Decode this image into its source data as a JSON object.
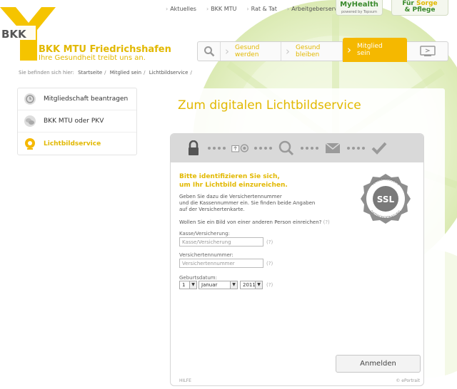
{
  "brand": {
    "logo_text": "BKK",
    "title": "BKK MTU Friedrichshafen",
    "tagline": "Ihre Gesundheit treibt uns an."
  },
  "topnav": {
    "items": [
      "Aktuelles",
      "BKK MTU",
      "Rat & Tat",
      "Arbeitgeberservice"
    ]
  },
  "partners": {
    "myhealth": "MyHealth",
    "myhealth_sub": "powered by Topsum",
    "pflege_prefix": "Für",
    "pflege_1": "Sorge",
    "pflege_2": "& Pflege"
  },
  "mainnav": {
    "item1_l1": "Gesund",
    "item1_l2": "werden",
    "item2_l1": "Gesund",
    "item2_l2": "bleiben",
    "item3_l1": "Mitglied",
    "item3_l2": "sein"
  },
  "breadcrumb": {
    "prefix": "Sie befinden sich hier:",
    "items": [
      "Startseite",
      "Mitglied sein",
      "Lichtbildservice"
    ]
  },
  "sidebar": {
    "items": [
      {
        "label": "Mitgliedschaft beantragen"
      },
      {
        "label": "BKK MTU oder PKV"
      },
      {
        "label": "Lichtbildservice"
      }
    ]
  },
  "main": {
    "title": "Zum digitalen Lichtbildservice"
  },
  "form": {
    "heading1": "Bitte identifizieren Sie sich,",
    "heading2": "um Ihr Lichtbild einzureichen.",
    "text1": "Geben Sie dazu die Versichertennummer",
    "text2": "und die Kassennummer ein. Sie finden beide Angaben",
    "text3": "auf der Versichertenkarte.",
    "other_person": "Wollen Sie ein Bild von einer anderen Person einreichen?",
    "help": "(?)",
    "kasse_label": "Kasse/Versicherung:",
    "kasse_placeholder": "Kasse/Versicherung",
    "vnr_label": "Versichertennummer:",
    "vnr_placeholder": "Versichertennummer",
    "dob_label": "Geburtsdatum:",
    "dob_day": "1",
    "dob_month": "Januar",
    "dob_year": "2011",
    "submit": "Anmelden",
    "footer_help": "HILFE",
    "footer_brand": "© ePortrait"
  },
  "ssl": {
    "text": "SSL",
    "ring_top": "VERSCHLÜSSELTE",
    "ring_bottom": "DATENÜBERTRAGUNG"
  },
  "colors": {
    "accent": "#f5b800",
    "brand_yellow": "#e2b800",
    "step_gray": "#d9d9d9"
  }
}
